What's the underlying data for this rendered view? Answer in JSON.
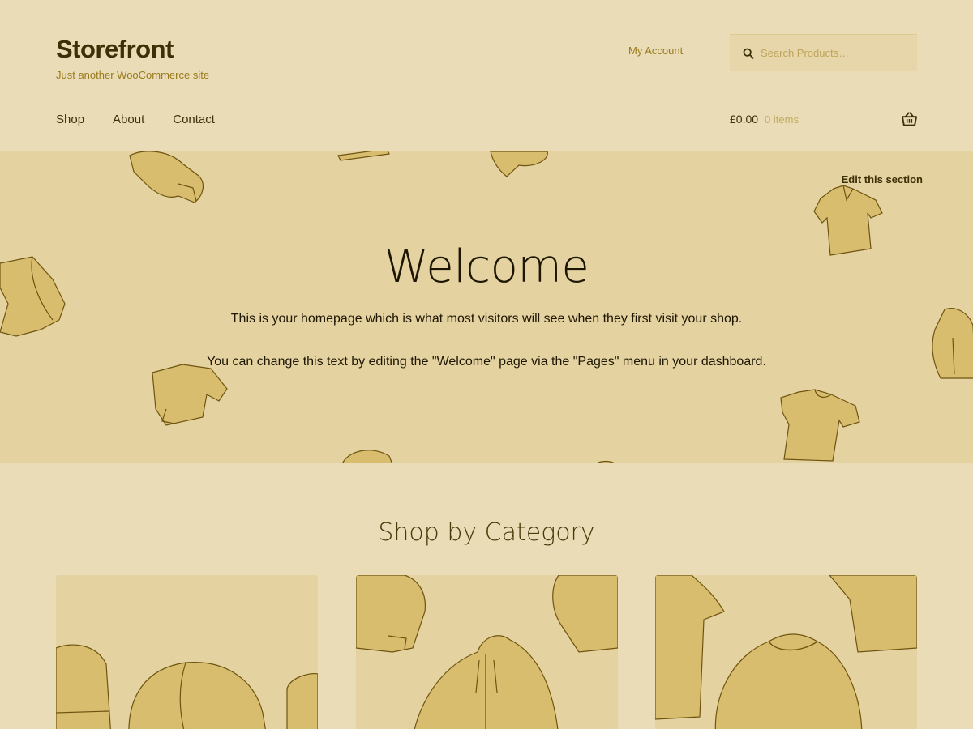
{
  "header": {
    "site_title": "Storefront",
    "tagline": "Just another WooCommerce site",
    "account_link": "My Account",
    "search_placeholder": "Search Products…"
  },
  "nav": {
    "items": [
      {
        "label": "Shop"
      },
      {
        "label": "About"
      },
      {
        "label": "Contact"
      }
    ]
  },
  "cart": {
    "amount": "£0.00",
    "count": "0 items"
  },
  "hero": {
    "edit_link": "Edit this section",
    "title": "Welcome",
    "paragraph_1": "This is your homepage which is what most visitors will see when they first visit your shop.",
    "paragraph_2": "You can change this text by editing the \"Welcome\" page via the \"Pages\" menu in your dashboard."
  },
  "categories": {
    "title": "Shop by Category"
  },
  "colors": {
    "background": "#e9dcb6",
    "hero_background": "#e4d2a0",
    "accent": "#9a7a1c",
    "text": "#3d2f06",
    "clothing_fill": "#d8bd6e",
    "clothing_stroke": "#6e5410"
  },
  "icons": [
    "search-icon",
    "basket-icon"
  ]
}
